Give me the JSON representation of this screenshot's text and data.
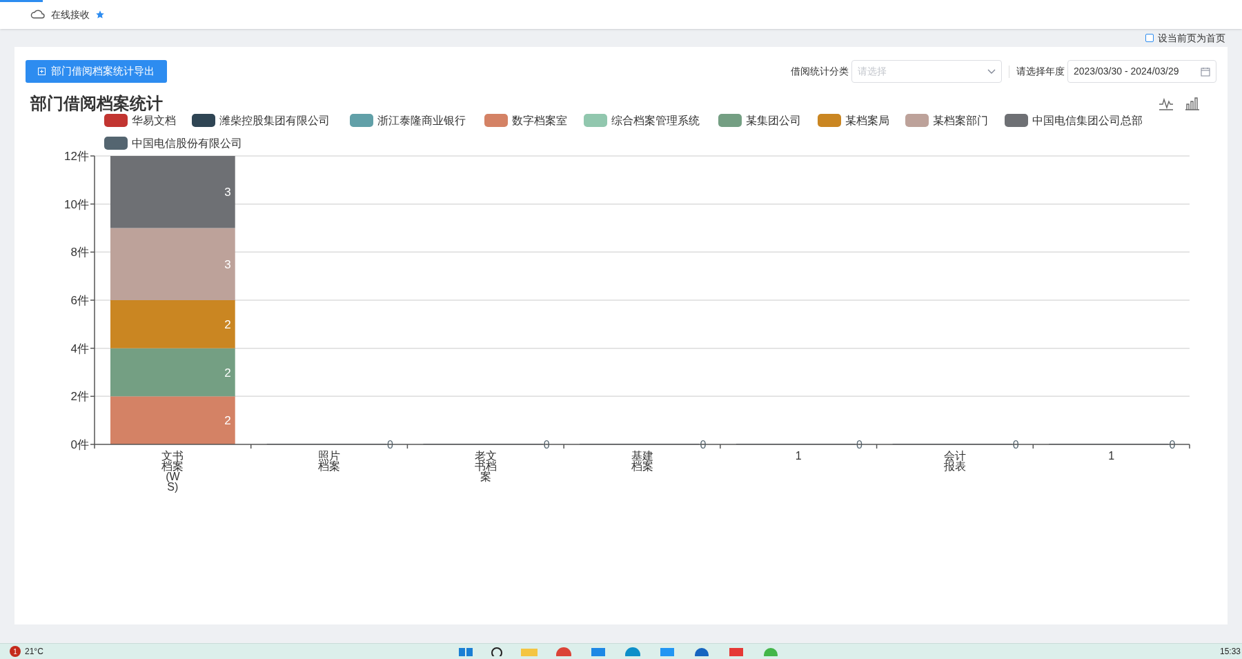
{
  "top_bar": {
    "link": "在线接收"
  },
  "home_checkbox": {
    "label": "设当前页为首页",
    "checked": false
  },
  "toolbar": {
    "export_button": "部门借阅档案统计导出",
    "category_label": "借阅统计分类",
    "category_select": {
      "placeholder": "请选择"
    },
    "year_label": "请选择年度",
    "date_range": "2023/03/30 - 2024/03/29"
  },
  "chart": {
    "title": "部门借阅档案统计",
    "chart_data": {
      "type": "bar",
      "stacked": true,
      "grid": true,
      "legend": true,
      "categories": [
        "文书档案(WS)",
        "照片档案",
        "老文书档案",
        "基建档案",
        "1",
        "会计报表",
        "1"
      ],
      "ylim": [
        0,
        12
      ],
      "yticks": [
        {
          "value": 0,
          "label": "0件"
        },
        {
          "value": 2,
          "label": "2件"
        },
        {
          "value": 4,
          "label": "4件"
        },
        {
          "value": 6,
          "label": "6件"
        },
        {
          "value": 8,
          "label": "8件"
        },
        {
          "value": 10,
          "label": "10件"
        },
        {
          "value": 12,
          "label": "12件"
        }
      ],
      "series": [
        {
          "name": "华易文档",
          "color": "#c23531",
          "values": [
            0,
            0,
            0,
            0,
            0,
            0,
            0
          ],
          "value_labels": [
            null,
            null,
            null,
            null,
            null,
            null,
            null
          ]
        },
        {
          "name": "潍柴控股集团有限公司",
          "color": "#2f4554",
          "values": [
            0,
            0,
            0,
            0,
            0,
            0,
            0
          ],
          "value_labels": [
            null,
            null,
            null,
            null,
            null,
            null,
            null
          ]
        },
        {
          "name": "浙江泰隆商业银行",
          "color": "#61a0a8",
          "values": [
            0,
            0,
            0,
            0,
            0,
            0,
            0
          ],
          "value_labels": [
            null,
            null,
            null,
            null,
            null,
            null,
            null
          ]
        },
        {
          "name": "数字档案室",
          "color": "#d48265",
          "values": [
            2,
            0,
            0,
            0,
            0,
            0,
            0
          ],
          "value_labels": [
            "2",
            null,
            null,
            null,
            null,
            null,
            null
          ]
        },
        {
          "name": "综合档案管理系统",
          "color": "#91c7ae",
          "values": [
            0,
            0,
            0,
            0,
            0,
            0,
            0
          ],
          "value_labels": [
            null,
            null,
            null,
            null,
            null,
            null,
            null
          ]
        },
        {
          "name": "某集团公司",
          "color": "#749f83",
          "values": [
            2,
            0,
            0,
            0,
            0,
            0,
            0
          ],
          "value_labels": [
            "2",
            null,
            null,
            null,
            null,
            null,
            null
          ]
        },
        {
          "name": "某档案局",
          "color": "#ca8622",
          "values": [
            2,
            0,
            0,
            0,
            0,
            0,
            0
          ],
          "value_labels": [
            "2",
            null,
            null,
            null,
            null,
            null,
            null
          ]
        },
        {
          "name": "某档案部门",
          "color": "#bda29a",
          "values": [
            3,
            0,
            0,
            0,
            0,
            0,
            0
          ],
          "value_labels": [
            "3",
            null,
            null,
            null,
            null,
            null,
            null
          ]
        },
        {
          "name": "中国电信集团公司总部",
          "color": "#6e7074",
          "values": [
            3,
            0,
            0,
            0,
            0,
            0,
            0
          ],
          "value_labels": [
            "3",
            null,
            null,
            null,
            null,
            null,
            null
          ]
        },
        {
          "name": "中国电信股份有限公司",
          "color": "#546570",
          "values": [
            0,
            0,
            0,
            0,
            0,
            0,
            0
          ],
          "value_labels": [
            null,
            "0",
            "0",
            "0",
            "0",
            "0",
            "0"
          ]
        }
      ]
    }
  },
  "taskbar": {
    "weather_badge": "1",
    "temperature": "21°C",
    "clock": "15:33"
  }
}
